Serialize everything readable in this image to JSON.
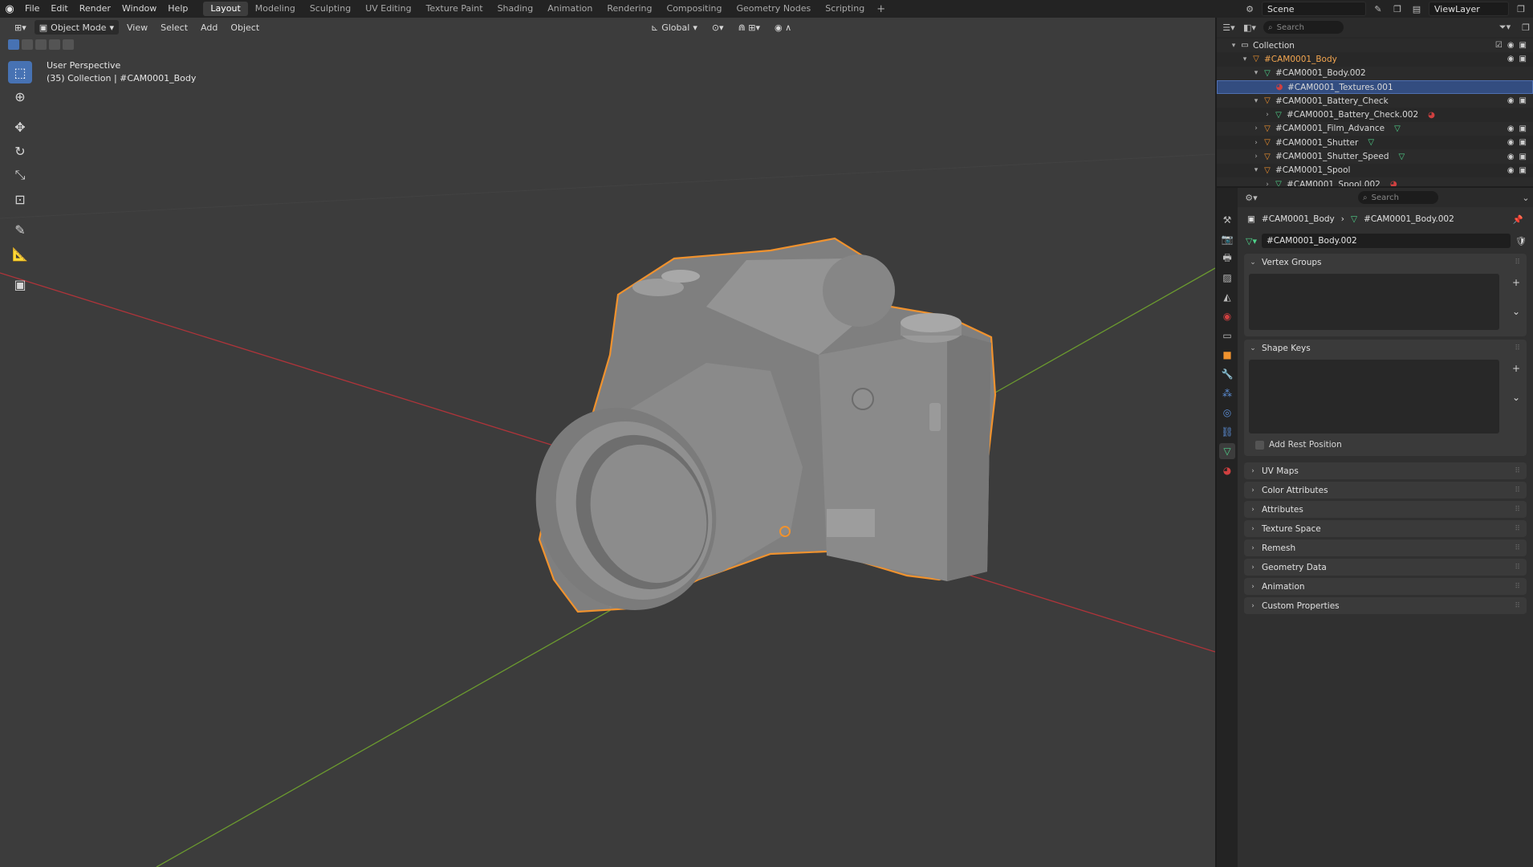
{
  "topbar": {
    "menus": [
      "File",
      "Edit",
      "Render",
      "Window",
      "Help"
    ],
    "workspaces": [
      "Layout",
      "Modeling",
      "Sculpting",
      "UV Editing",
      "Texture Paint",
      "Shading",
      "Animation",
      "Rendering",
      "Compositing",
      "Geometry Nodes",
      "Scripting"
    ],
    "active_workspace": "Layout",
    "add_tab": "+",
    "scene": "Scene",
    "view_layer": "ViewLayer"
  },
  "viewport": {
    "mode": "Object Mode",
    "menus": [
      "View",
      "Select",
      "Add",
      "Object"
    ],
    "orientation": "Global",
    "info_line1": "User Perspective",
    "info_line2": "(35) Collection | #CAM0001_Body",
    "colors": {
      "background": "#3c3c3c",
      "x_axis": "#b0343a",
      "y_axis": "#6b9a2f",
      "selection": "#f0922e",
      "mesh": "#8d8d8d"
    }
  },
  "toolbar": {
    "tools": [
      "select-box",
      "cursor",
      "move",
      "rotate",
      "scale",
      "transform",
      "annotate",
      "measure",
      "add-cube"
    ]
  },
  "outliner": {
    "search_placeholder": "Search",
    "rows": [
      {
        "label": "Collection",
        "indent": 1,
        "arrow": "▾",
        "icon": "collection",
        "vis": true
      },
      {
        "label": "#CAM0001_Body",
        "indent": 2,
        "arrow": "▾",
        "icon": "object",
        "vis": true,
        "selected": true
      },
      {
        "label": "#CAM0001_Body.002",
        "indent": 3,
        "arrow": "▾",
        "icon": "mesh",
        "vis": false
      },
      {
        "label": "#CAM0001_Textures.001",
        "indent": 4,
        "arrow": "",
        "icon": "material",
        "vis": false,
        "active": true
      },
      {
        "label": "#CAM0001_Battery_Check",
        "indent": 3,
        "arrow": "▾",
        "icon": "object",
        "vis": true
      },
      {
        "label": "#CAM0001_Battery_Check.002",
        "indent": 4,
        "arrow": "›",
        "icon": "mesh",
        "vis": false,
        "extra": "material"
      },
      {
        "label": "#CAM0001_Film_Advance",
        "indent": 3,
        "arrow": "›",
        "icon": "object",
        "vis": true,
        "extra": "mesh"
      },
      {
        "label": "#CAM0001_Shutter",
        "indent": 3,
        "arrow": "›",
        "icon": "object",
        "vis": true,
        "extra": "mesh"
      },
      {
        "label": "#CAM0001_Shutter_Speed",
        "indent": 3,
        "arrow": "›",
        "icon": "object",
        "vis": true,
        "extra": "mesh"
      },
      {
        "label": "#CAM0001_Spool",
        "indent": 3,
        "arrow": "▾",
        "icon": "object",
        "vis": true
      },
      {
        "label": "#CAM0001_Spool.002",
        "indent": 4,
        "arrow": "›",
        "icon": "mesh",
        "vis": false,
        "extra": "material"
      }
    ]
  },
  "properties": {
    "search_placeholder": "Search",
    "breadcrumb_object": "#CAM0001_Body",
    "breadcrumb_sep": "›",
    "breadcrumb_mesh": "#CAM0001_Body.002",
    "mesh_name": "#CAM0001_Body.002",
    "vertex_groups": "Vertex Groups",
    "shape_keys": "Shape Keys",
    "add_rest_position": "Add Rest Position",
    "collapsed_panels": [
      "UV Maps",
      "Color Attributes",
      "Attributes",
      "Texture Space",
      "Remesh",
      "Geometry Data",
      "Animation",
      "Custom Properties"
    ]
  }
}
